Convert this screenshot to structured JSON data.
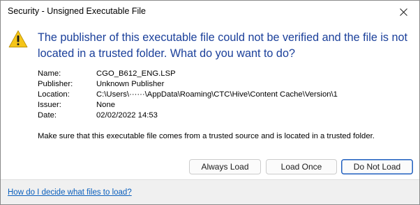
{
  "window": {
    "title": "Security - Unsigned Executable File"
  },
  "message": {
    "heading": "The publisher of this executable file could not be verified and the file is not located in a trusted folder. What do you want to do?"
  },
  "details": [
    {
      "label": "Name:",
      "value": "CGO_B612_ENG.LSP"
    },
    {
      "label": "Publisher:",
      "value": "Unknown Publisher"
    },
    {
      "label": "Location:",
      "value": "C:\\Users\\······\\AppData\\Roaming\\CTC\\Hive\\Content Cache\\Version\\1"
    },
    {
      "label": "Issuer:",
      "value": "None"
    },
    {
      "label": "Date:",
      "value": "02/02/2022  14:53"
    }
  ],
  "note": "Make sure that this executable file comes from a trusted source and is located in a trusted folder.",
  "buttons": {
    "always_load": "Always Load",
    "load_once": "Load Once",
    "do_not_load": "Do Not Load"
  },
  "footer": {
    "help_link": "How do I decide what files to load?"
  },
  "icons": {
    "warning": "warning-icon",
    "close": "close-icon"
  },
  "colors": {
    "heading": "#1a3f9a",
    "link": "#0a5fbd",
    "default_button_border": "#1f5fbf",
    "warning_fill": "#f5c518"
  }
}
